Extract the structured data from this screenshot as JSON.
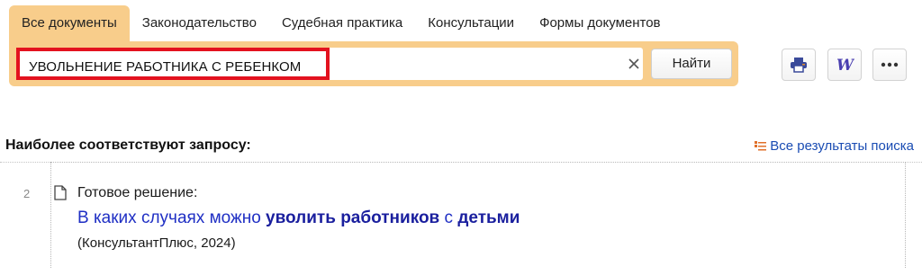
{
  "tabs": [
    "Все документы",
    "Законодательство",
    "Судебная практика",
    "Консультации",
    "Формы документов"
  ],
  "search": {
    "query": "УВОЛЬНЕНИЕ РАБОТНИКА С РЕБЕНКОМ",
    "find_label": "Найти"
  },
  "toolbar": {
    "print_icon": "print-icon",
    "word_icon": "word-export-icon",
    "more_icon": "more-icon"
  },
  "results": {
    "heading": "Наиболее соответствуют запросу:",
    "all_results_label": "Все результаты поиска",
    "items": [
      {
        "number": "2",
        "kind": "Готовое решение:",
        "title_parts": [
          "В каких случаях можно ",
          "уволить работников",
          " с ",
          "детьми"
        ],
        "source": "(КонсультантПлюс, 2024)"
      }
    ]
  },
  "colors": {
    "accent": "#f8cd8b",
    "highlight_border": "#e3121f",
    "link": "#1f2fc4"
  }
}
